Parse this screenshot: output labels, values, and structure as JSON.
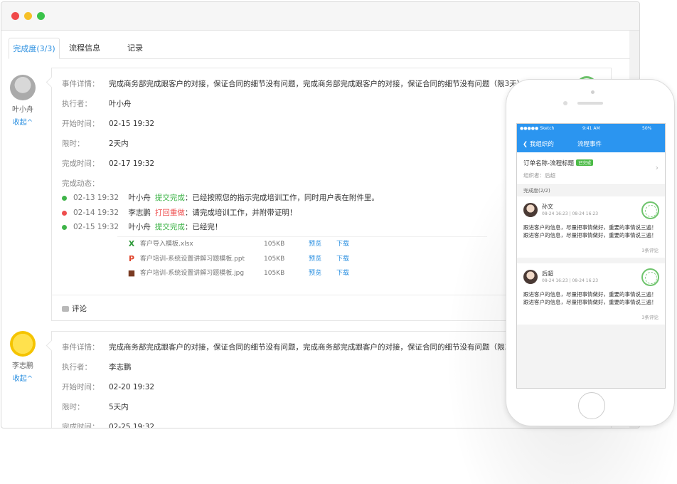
{
  "window": {
    "buttons": [
      "close",
      "minimize",
      "maximize"
    ]
  },
  "tabs": [
    {
      "label": "完成度(3/3)",
      "active": true
    },
    {
      "label": "流程信息",
      "active": false
    },
    {
      "label": "记录",
      "active": false
    }
  ],
  "cards": [
    {
      "user": "叶小舟",
      "collapse": "收起^",
      "labels": {
        "detail": "事件详情：",
        "executor": "执行者：",
        "start": "开始时间：",
        "limit": "限时：",
        "finish": "完成时间：",
        "dynamic": "完成动态："
      },
      "detail": "完成商务部完成跟客户的对接，保证合同的细节没有问题，完成商务部完成跟客户的对接，保证合同的细节没有问题（限3天）",
      "executor": "叶小舟",
      "start": "02-15 19:32",
      "limit": "2天内",
      "finish": "02-17 19:32",
      "feed": [
        {
          "time": "02-13 19:32",
          "user": "叶小舟",
          "action": "提交完成",
          "text": "：已经按照您的指示完成培训工作，同时用户表在附件里。",
          "status": "ok"
        },
        {
          "time": "02-14 19:32",
          "user": "李志鹏",
          "action": "打回重做",
          "text": "：请完成培训工作，并附带证明！",
          "status": "bad"
        },
        {
          "time": "02-15 19:32",
          "user": "叶小舟",
          "action": "提交完成",
          "text": "：已经完！",
          "status": "ok"
        }
      ],
      "files": [
        {
          "name": "客户导入模板.xlsx",
          "size": "105KB",
          "preview": "预览",
          "download": "下载",
          "icon": "excel-icon",
          "glyph": "X",
          "color": "#2e9a3a"
        },
        {
          "name": "客户培训-系统设置讲解习题模板.ppt",
          "size": "105KB",
          "preview": "预览",
          "download": "下载",
          "icon": "ppt-icon",
          "glyph": "P",
          "color": "#e0452c"
        },
        {
          "name": "客户培训-系统设置讲解习题模板.jpg",
          "size": "105KB",
          "preview": "预览",
          "download": "下载",
          "icon": "image-icon",
          "glyph": "■",
          "color": "#7a3b22"
        }
      ],
      "comment": "评论"
    },
    {
      "user": "李志鹏",
      "collapse": "收起^",
      "labels": {
        "detail": "事件详情：",
        "executor": "执行者：",
        "start": "开始时间：",
        "limit": "限时：",
        "finish": "完成时间："
      },
      "detail": "完成商务部完成跟客户的对接，保证合同的细节没有问题，完成商务部完成跟客户的对接，保证合同的细节没有问题（限3天）",
      "executor": "李志鹏",
      "start": "02-20 19:32",
      "limit": "5天内",
      "finish": "02-25 19:32"
    }
  ],
  "phone": {
    "status": {
      "carrier": "●●●●● Sketch",
      "time": "9:41 AM",
      "battery": "50%"
    },
    "nav": {
      "back": "我组织的",
      "title": "流程事件"
    },
    "order": {
      "title": "订单名称-流程标题",
      "badge": "已完成",
      "sub": "组织者：后超"
    },
    "progress": "完成度(2/2)",
    "items": [
      {
        "name": "孙文",
        "time": "08-24 16:23 | 08-24 16:23",
        "text": "跟进客户的信息，尽量把事情做好，重要的事情说三遍！跟进客户的信息，尽量把事情做好，重要的事情说三遍！",
        "comments": "3条评论"
      },
      {
        "name": "后超",
        "time": "08-24 16:23 | 08-24 16:23",
        "text": "跟进客户的信息，尽量把事情做好，重要的事情说三遍！跟进客户的信息，尽量把事情做好，重要的事情说三遍！",
        "comments": "3条评论"
      }
    ]
  },
  "colors": {
    "accent": "#2a8fe0",
    "success": "#3fb449",
    "danger": "#ee4d4d",
    "phone_bar": "#2b95f0"
  }
}
